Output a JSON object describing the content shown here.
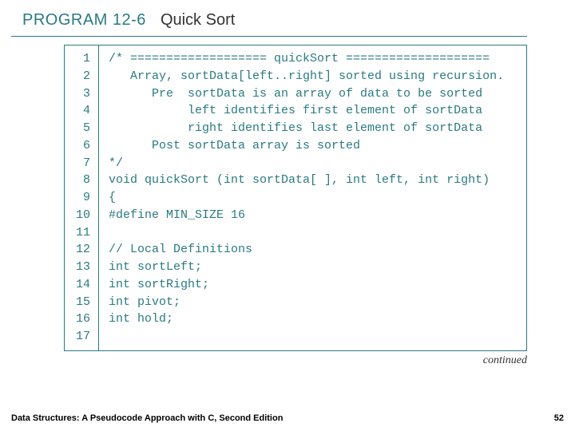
{
  "header": {
    "program_label": "PROGRAM 12-6",
    "program_title": "Quick Sort"
  },
  "code": {
    "lines": [
      "/* =================== quickSort ====================",
      "   Array, sortData[left..right] sorted using recursion.",
      "      Pre  sortData is an array of data to be sorted",
      "           left identifies first element of sortData",
      "           right identifies last element of sortData",
      "      Post sortData array is sorted",
      "*/",
      "void quickSort (int sortData[ ], int left, int right)",
      "{",
      "#define MIN_SIZE 16",
      "",
      "// Local Definitions",
      "int sortLeft;",
      "int sortRight;",
      "int pivot;",
      "int hold;",
      ""
    ]
  },
  "continued_label": "continued",
  "footer": {
    "book_title": "Data Structures: A Pseudocode Approach with C, Second Edition",
    "page_number": "52"
  }
}
